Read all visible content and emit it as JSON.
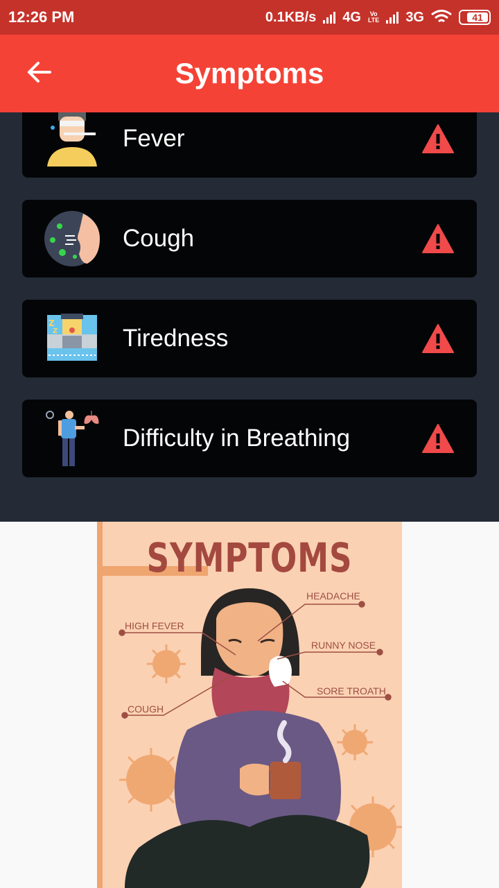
{
  "status_bar": {
    "time": "12:26 PM",
    "network_speed": "0.1KB/s",
    "net1": "4G",
    "volte": "Vo\nLTE",
    "net2": "3G",
    "battery": "41"
  },
  "app_bar": {
    "title": "Symptoms"
  },
  "symptoms": [
    {
      "label": "Fever",
      "icon": "fever-icon"
    },
    {
      "label": "Cough",
      "icon": "cough-icon"
    },
    {
      "label": "Tiredness",
      "icon": "tiredness-icon"
    },
    {
      "label": "Difficulty in Breathing",
      "icon": "breathing-icon"
    }
  ],
  "poster": {
    "title": "SYMPTOMS",
    "labels": {
      "headache": "HEADACHE",
      "high_fever": "HIGH FEVER",
      "runny_nose": "RUNNY NOSE",
      "sore_throat": "SORE TROATH",
      "cough": "COUGH"
    }
  },
  "colors": {
    "accent": "#f44336",
    "status": "#c5322a",
    "background": "#242b37",
    "card": "#040507",
    "warning": "#f04a4a"
  }
}
